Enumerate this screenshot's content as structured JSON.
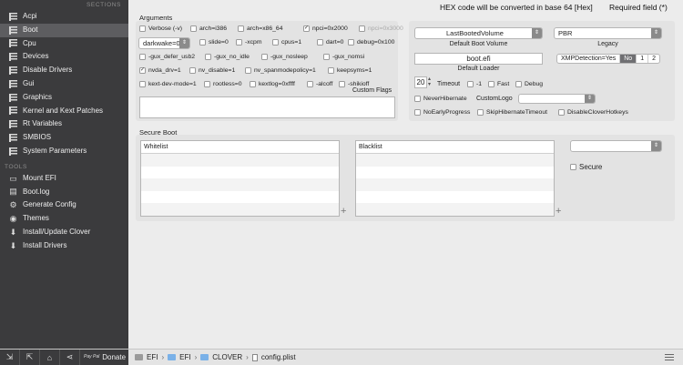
{
  "sidebar": {
    "sections_header": "SECTIONS",
    "sections": [
      {
        "label": "Acpi",
        "selected": false
      },
      {
        "label": "Boot",
        "selected": true
      },
      {
        "label": "Cpu",
        "selected": false
      },
      {
        "label": "Devices",
        "selected": false
      },
      {
        "label": "Disable Drivers",
        "selected": false
      },
      {
        "label": "Gui",
        "selected": false
      },
      {
        "label": "Graphics",
        "selected": false
      },
      {
        "label": "Kernel and Kext Patches",
        "selected": false
      },
      {
        "label": "Rt Variables",
        "selected": false
      },
      {
        "label": "SMBIOS",
        "selected": false
      },
      {
        "label": "System Parameters",
        "selected": false
      }
    ],
    "tools_header": "TOOLS",
    "tools": [
      {
        "label": "Mount EFI",
        "icon": "drive-icon"
      },
      {
        "label": "Boot.log",
        "icon": "document-icon"
      },
      {
        "label": "Generate Config",
        "icon": "gear-icon"
      },
      {
        "label": "Themes",
        "icon": "palette-icon"
      },
      {
        "label": "Install/Update Clover",
        "icon": "download-icon"
      },
      {
        "label": "Install Drivers",
        "icon": "install-icon"
      }
    ]
  },
  "header": {
    "hex_note": "HEX code will be converted in base 64 [Hex]",
    "required_note": "Required field (*)"
  },
  "arguments": {
    "title": "Arguments",
    "row1": [
      {
        "label": "Verbose (-v)",
        "checked": false,
        "disabled": false
      },
      {
        "label": "arch=i386",
        "checked": false,
        "disabled": false
      },
      {
        "label": "arch=x86_64",
        "checked": false,
        "disabled": false
      },
      {
        "label": "npci=0x2000",
        "checked": true,
        "disabled": false
      },
      {
        "label": "npci=0x3000",
        "checked": false,
        "disabled": true
      }
    ],
    "darkwake_value": "darkwake=0",
    "row2": [
      {
        "label": "slide=0",
        "checked": false
      },
      {
        "label": "-xcpm",
        "checked": false
      },
      {
        "label": "cpus=1",
        "checked": false
      },
      {
        "label": "dart=0",
        "checked": false
      },
      {
        "label": "debug=0x100",
        "checked": false
      }
    ],
    "row3": [
      {
        "label": "-gux_defer_usb2",
        "checked": false
      },
      {
        "label": "-gux_no_idle",
        "checked": false
      },
      {
        "label": "-gux_nosleep",
        "checked": false
      },
      {
        "label": "-gux_nomsi",
        "checked": false
      }
    ],
    "row4": [
      {
        "label": "nvda_drv=1",
        "checked": true
      },
      {
        "label": "nv_disable=1",
        "checked": false
      },
      {
        "label": "nv_spanmodepolicy=1",
        "checked": false
      },
      {
        "label": "keepsyms=1",
        "checked": false
      }
    ],
    "row5": [
      {
        "label": "kext-dev-mode=1",
        "checked": false
      },
      {
        "label": "rootless=0",
        "checked": false
      },
      {
        "label": "kextlog=0xffff",
        "checked": false
      },
      {
        "label": "-alcoff",
        "checked": false
      },
      {
        "label": "-shikioff",
        "checked": false
      }
    ],
    "custom_flags_label": "Custom Flags",
    "custom_flags_value": ""
  },
  "boot_settings": {
    "default_volume_value": "LastBootedVolume",
    "default_volume_label": "Default Boot Volume",
    "legacy_value": "PBR",
    "legacy_label": "Legacy",
    "default_loader_value": "boot.efi",
    "default_loader_label": "Default Loader",
    "xmp_label": "XMPDetection=Yes",
    "xmp_options": [
      {
        "label": "No",
        "selected": true
      },
      {
        "label": "1",
        "selected": false
      },
      {
        "label": "2",
        "selected": false
      }
    ],
    "timeout_value": "20",
    "timeout_label": "Timeout",
    "timeout_options": [
      {
        "label": "-1",
        "checked": false
      },
      {
        "label": "Fast",
        "checked": false
      },
      {
        "label": "Debug",
        "checked": false
      }
    ],
    "never_hibernate_label": "NeverHibernate",
    "custom_logo_label": "CustomLogo",
    "custom_logo_value": "",
    "bottom_options": [
      {
        "label": "NoEarlyProgress",
        "checked": false
      },
      {
        "label": "SkipHibernateTimeout",
        "checked": false
      },
      {
        "label": "DisableCloverHotkeys",
        "checked": false
      }
    ]
  },
  "secure_boot": {
    "title": "Secure Boot",
    "whitelist_header": "Whitelist",
    "blacklist_header": "Blacklist",
    "policy_value": "",
    "secure_label": "Secure",
    "add_symbol": "+"
  },
  "bottom_bar": {
    "donate_label": "Donate",
    "paypal_label": "Pay Pal",
    "breadcrumbs": [
      {
        "label": "EFI",
        "type": "drive"
      },
      {
        "label": "EFI",
        "type": "folder"
      },
      {
        "label": "CLOVER",
        "type": "folder"
      },
      {
        "label": "config.plist",
        "type": "file"
      }
    ],
    "separator": "›"
  },
  "colors": {
    "sidebar_bg": "#3b3b3d",
    "sidebar_selected": "#5d5d60",
    "panel_bg": "#e3e3e3",
    "folder_blue": "#7ab1e8"
  }
}
